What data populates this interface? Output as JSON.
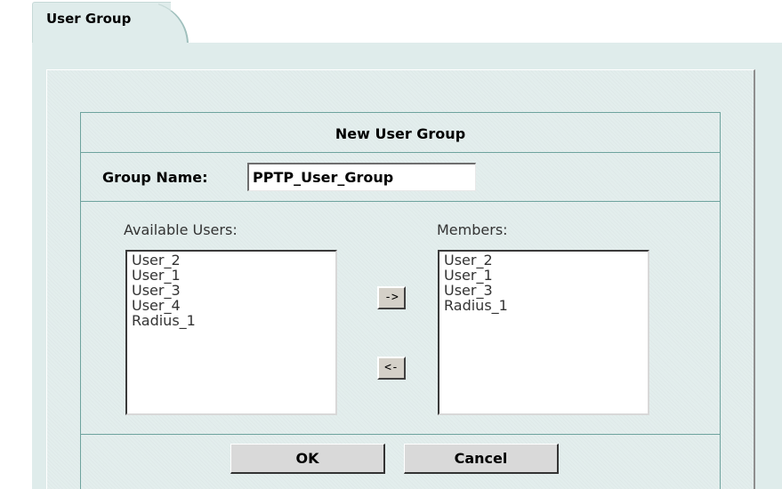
{
  "tab": {
    "label": "User Group"
  },
  "dialog": {
    "title": "New User Group",
    "group_name_label": "Group Name:",
    "group_name_value": "PPTP_User_Group",
    "available_label": "Available Users:",
    "available_users": [
      "User_2",
      "User_1",
      "User_3",
      "User_4",
      "Radius_1"
    ],
    "members_label": "Members:",
    "members": [
      "User_2",
      "User_1",
      "User_3",
      "Radius_1"
    ],
    "add_button": "->",
    "remove_button": "<-",
    "ok_button": "OK",
    "cancel_button": "Cancel"
  }
}
